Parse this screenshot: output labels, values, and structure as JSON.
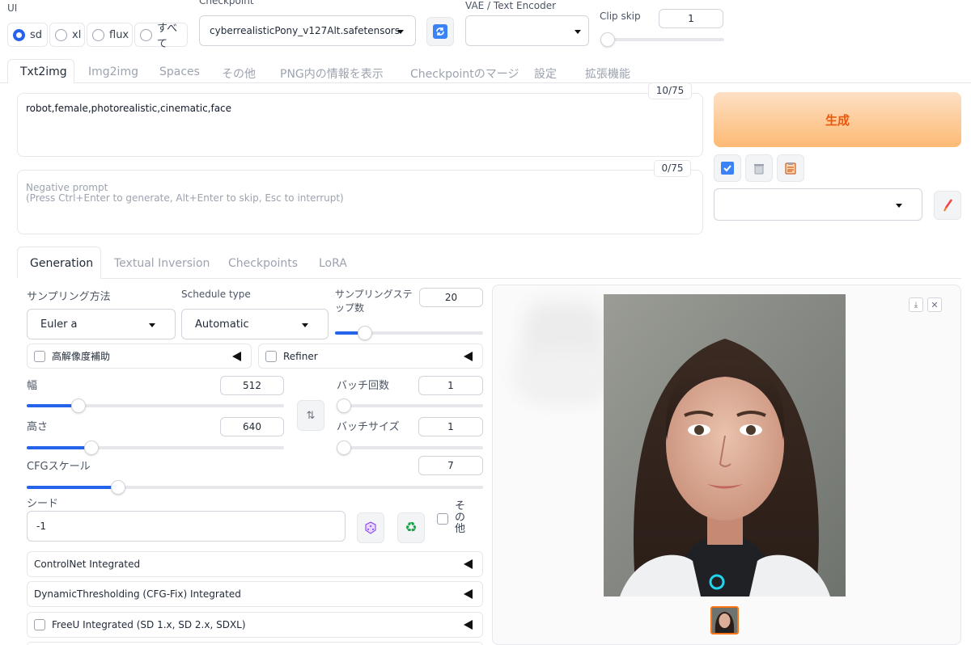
{
  "top": {
    "ui_label": "UI",
    "ui_options": [
      "sd",
      "xl",
      "flux",
      "すべて"
    ],
    "checkpoint_label": "Checkpoint",
    "checkpoint_value": "cyberrealisticPony_v127Alt.safetensors",
    "vae_label": "VAE / Text Encoder",
    "vae_value": "",
    "clip_skip_label": "Clip skip",
    "clip_skip_value": "1"
  },
  "main_tabs": [
    "Txt2img",
    "Img2img",
    "Spaces",
    "その他",
    "PNG内の情報を表示",
    "Checkpointのマージ",
    "設定",
    "拡張機能"
  ],
  "prompt": {
    "text": "robot,female,photorealistic,cinematic,face",
    "counter": "10/75"
  },
  "negative": {
    "placeholder_line1": "Negative prompt",
    "placeholder_line2": "(Press Ctrl+Enter to generate, Alt+Enter to skip, Esc to interrupt)",
    "counter": "0/75"
  },
  "generate_label": "生成",
  "sub_tabs": [
    "Generation",
    "Textual Inversion",
    "Checkpoints",
    "LoRA"
  ],
  "gen": {
    "sampling_method_label": "サンプリング方法",
    "sampling_method_value": "Euler a",
    "schedule_type_label": "Schedule type",
    "schedule_type_value": "Automatic",
    "steps_label": "サンプリングステップ数",
    "steps_value": "20",
    "steps_level": 0.2,
    "hires_label": "高解像度補助",
    "refiner_label": "Refiner",
    "width_label": "幅",
    "width_value": "512",
    "width_level": 0.2,
    "height_label": "高さ",
    "height_value": "640",
    "height_level": 0.25,
    "batch_count_label": "バッチ回数",
    "batch_count_value": "1",
    "batch_size_label": "バッチサイズ",
    "batch_size_value": "1",
    "cfg_label": "CFGスケール",
    "cfg_value": "7",
    "cfg_level": 0.2,
    "seed_label": "シード",
    "seed_value": "-1",
    "extra_label": "その他"
  },
  "accordions": [
    "ControlNet Integrated",
    "DynamicThresholding (CFG-Fix) Integrated",
    "FreeU Integrated (SD 1.x, SD 2.x, SDXL)"
  ],
  "colors": {
    "accent": "#2563eb",
    "generate_from": "#fde0c5",
    "generate_to": "#fdba74",
    "generate_text": "#ea580c"
  },
  "icons": {
    "refresh": "refresh-icon",
    "checkbox_toggle": "check-icon",
    "trash": "trash-icon",
    "clipboard": "clipboard-icon",
    "brush": "brush-icon",
    "dice": "dice-icon",
    "recycle": "recycle-icon",
    "download": "download-icon",
    "close": "close-icon",
    "swap": "swap-icon"
  }
}
